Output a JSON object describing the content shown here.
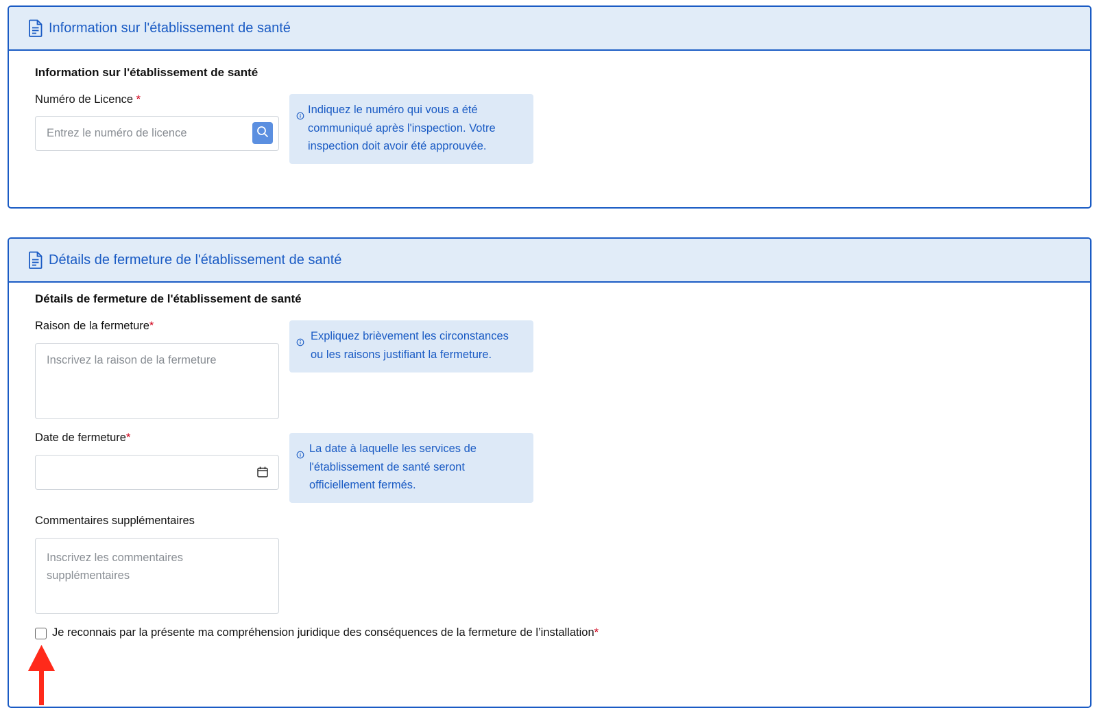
{
  "section1": {
    "header_title": "Information sur l'établissement de santé",
    "title": "Information sur l'établissement de santé",
    "license_label": "Numéro de Licence",
    "required_mark": "*",
    "license_placeholder": "Entrez le numéro de licence",
    "license_value": "",
    "license_info_lines": [
      "Indiquez le numéro qui vous a été",
      "communiqué après l'inspection. Votre",
      "inspection doit avoir été approuvée."
    ]
  },
  "section2": {
    "header_title": "Détails de fermeture de l'établissement de santé",
    "title": "Détails de fermeture de l'établissement de santé",
    "reason_label": "Raison de la fermeture",
    "required_mark": "*",
    "reason_placeholder": "Inscrivez la raison de la fermeture",
    "reason_value": "",
    "reason_info_lines": [
      "Expliquez brièvement les circonstances",
      "ou les raisons justifiant la fermeture."
    ],
    "date_label": "Date de fermeture",
    "date_value": "",
    "date_info_lines": [
      "La date à laquelle les services de",
      "l'établissement de santé seront",
      "officiellement fermés."
    ],
    "comments_label": "Commentaires supplémentaires",
    "comments_placeholder_lines": [
      "Inscrivez les commentaires",
      "supplémentaires"
    ],
    "comments_value": "",
    "ack_label": "Je reconnais par la présente ma compréhension juridique des conséquences de la fermeture de l’installation",
    "ack_checked": false
  },
  "icons": {
    "header": "document-icon",
    "info": "info-circle-icon",
    "search": "search-icon",
    "calendar": "calendar-icon",
    "annotation": "red-arrow-up"
  },
  "colors": {
    "accent": "#1a5bc4",
    "header_bg": "#e1ecf8",
    "info_bg": "#dde9f7",
    "required": "#d0021b",
    "search_button": "#5b8fe0",
    "annotation_arrow": "#ff2a1a"
  }
}
